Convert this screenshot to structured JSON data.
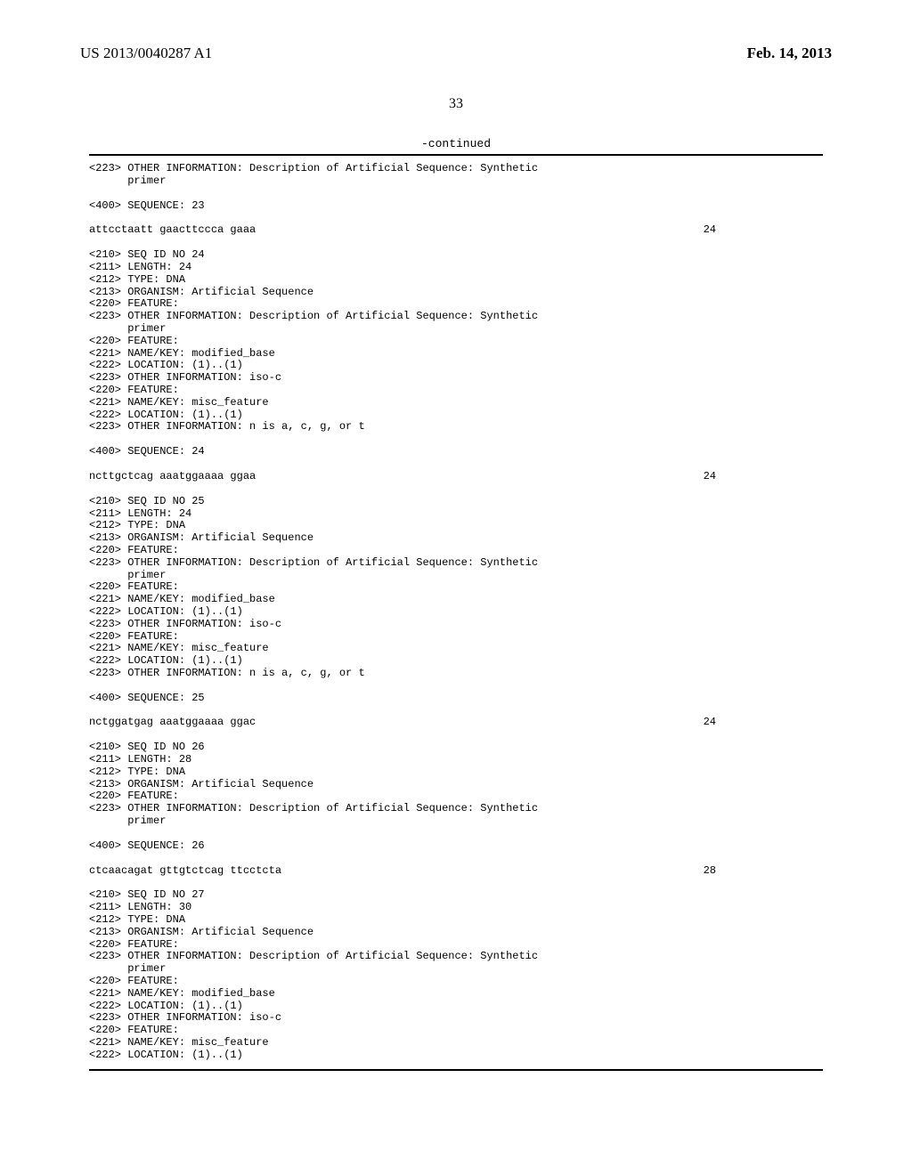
{
  "header": {
    "pub_number": "US 2013/0040287 A1",
    "pub_date": "Feb. 14, 2013",
    "page_number": "33",
    "continued": "-continued"
  },
  "entries": {
    "e23": {
      "other_info": "<223> OTHER INFORMATION: Description of Artificial Sequence: Synthetic",
      "other_info_cont": "      primer",
      "seq_header": "<400> SEQUENCE: 23",
      "seq": "attcctaatt gaacttccca gaaa",
      "seq_len": "24"
    },
    "e24": {
      "seqid": "<210> SEQ ID NO 24",
      "length": "<211> LENGTH: 24",
      "type": "<212> TYPE: DNA",
      "organism": "<213> ORGANISM: Artificial Sequence",
      "feature1": "<220> FEATURE:",
      "other_info": "<223> OTHER INFORMATION: Description of Artificial Sequence: Synthetic",
      "other_info_cont": "      primer",
      "feature2": "<220> FEATURE:",
      "namekey_mb": "<221> NAME/KEY: modified_base",
      "location1": "<222> LOCATION: (1)..(1)",
      "other_iso": "<223> OTHER INFORMATION: iso-c",
      "feature3": "<220> FEATURE:",
      "namekey_mf": "<221> NAME/KEY: misc_feature",
      "location2": "<222> LOCATION: (1)..(1)",
      "other_n": "<223> OTHER INFORMATION: n is a, c, g, or t",
      "seq_header": "<400> SEQUENCE: 24",
      "seq": "ncttgctcag aaatggaaaa ggaa",
      "seq_len": "24"
    },
    "e25": {
      "seqid": "<210> SEQ ID NO 25",
      "length": "<211> LENGTH: 24",
      "type": "<212> TYPE: DNA",
      "organism": "<213> ORGANISM: Artificial Sequence",
      "feature1": "<220> FEATURE:",
      "other_info": "<223> OTHER INFORMATION: Description of Artificial Sequence: Synthetic",
      "other_info_cont": "      primer",
      "feature2": "<220> FEATURE:",
      "namekey_mb": "<221> NAME/KEY: modified_base",
      "location1": "<222> LOCATION: (1)..(1)",
      "other_iso": "<223> OTHER INFORMATION: iso-c",
      "feature3": "<220> FEATURE:",
      "namekey_mf": "<221> NAME/KEY: misc_feature",
      "location2": "<222> LOCATION: (1)..(1)",
      "other_n": "<223> OTHER INFORMATION: n is a, c, g, or t",
      "seq_header": "<400> SEQUENCE: 25",
      "seq": "nctggatgag aaatggaaaa ggac",
      "seq_len": "24"
    },
    "e26": {
      "seqid": "<210> SEQ ID NO 26",
      "length": "<211> LENGTH: 28",
      "type": "<212> TYPE: DNA",
      "organism": "<213> ORGANISM: Artificial Sequence",
      "feature1": "<220> FEATURE:",
      "other_info": "<223> OTHER INFORMATION: Description of Artificial Sequence: Synthetic",
      "other_info_cont": "      primer",
      "seq_header": "<400> SEQUENCE: 26",
      "seq": "ctcaacagat gttgtctcag ttcctcta",
      "seq_len": "28"
    },
    "e27": {
      "seqid": "<210> SEQ ID NO 27",
      "length": "<211> LENGTH: 30",
      "type": "<212> TYPE: DNA",
      "organism": "<213> ORGANISM: Artificial Sequence",
      "feature1": "<220> FEATURE:",
      "other_info": "<223> OTHER INFORMATION: Description of Artificial Sequence: Synthetic",
      "other_info_cont": "      primer",
      "feature2": "<220> FEATURE:",
      "namekey_mb": "<221> NAME/KEY: modified_base",
      "location1": "<222> LOCATION: (1)..(1)",
      "other_iso": "<223> OTHER INFORMATION: iso-c",
      "feature3": "<220> FEATURE:",
      "namekey_mf": "<221> NAME/KEY: misc_feature",
      "location2": "<222> LOCATION: (1)..(1)"
    }
  }
}
